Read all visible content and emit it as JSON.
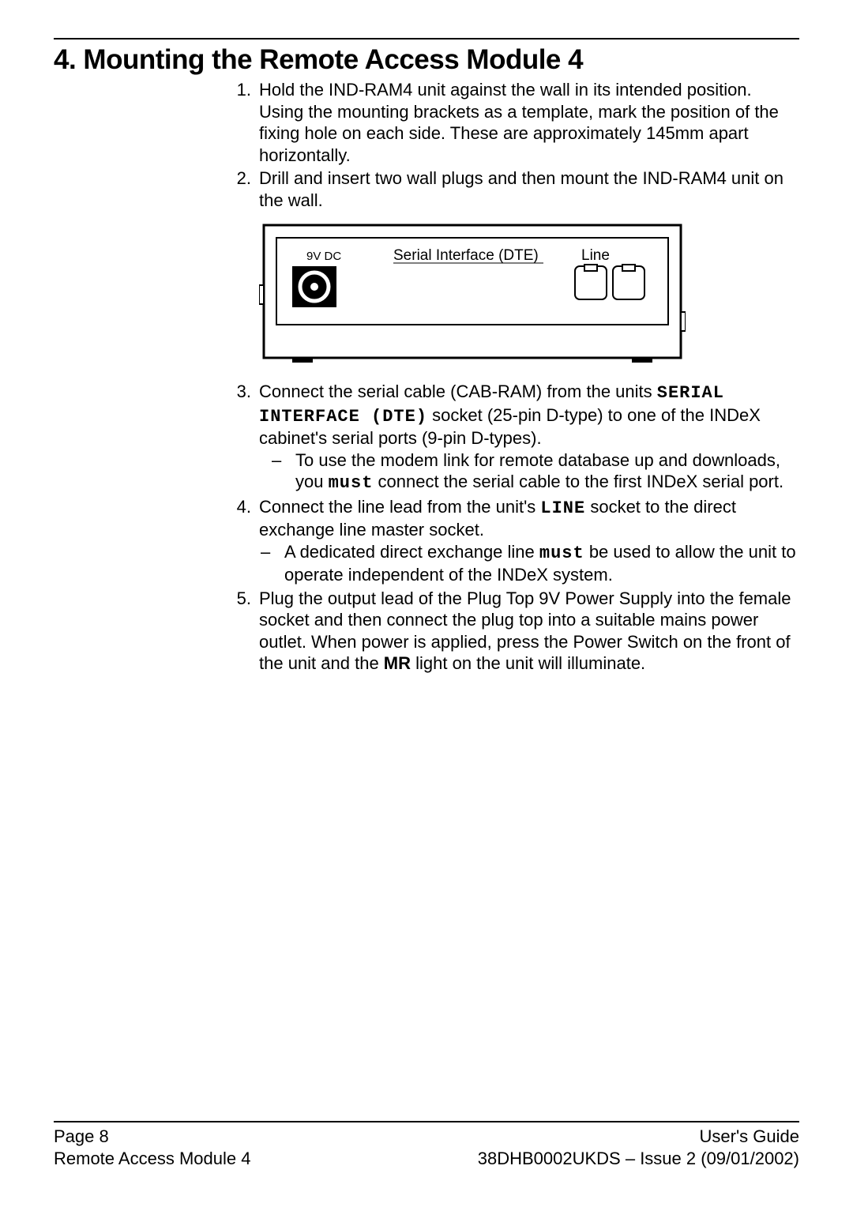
{
  "heading": "4. Mounting the Remote Access Module 4",
  "steps": {
    "s1": "Hold the IND-RAM4 unit against the wall in its intended position. Using the mounting brackets as a template, mark the position of the fixing hole on each side. These are approximately 145mm apart horizontally.",
    "s2": "Drill and insert two wall plugs and then mount the IND-RAM4 unit on the wall.",
    "s3_a": "Connect the serial cable (CAB-RAM) from the units ",
    "s3_b": "SERIAL INTERFACE (DTE)",
    "s3_c": " socket (25-pin D-type) to one of the INDeX cabinet's serial ports (9-pin D-types).",
    "s3_sub_a": "To use the modem link for remote database up and downloads, you ",
    "s3_sub_b": "must",
    "s3_sub_c": " connect the serial cable to the first INDeX serial port.",
    "s4_a": "Connect the line lead from the unit's ",
    "s4_b": "LINE",
    "s4_c": " socket to the direct exchange line master socket.",
    "s4_sub_a": "A dedicated direct exchange line ",
    "s4_sub_b": "must",
    "s4_sub_c": " be used to allow the unit to operate independent of the INDeX system.",
    "s5_a": "Plug the output lead of the Plug Top 9V Power Supply into the female socket and then connect the plug top into a suitable mains power outlet. When power is applied, press the Power Switch on the front of the unit and the ",
    "s5_b": "MR",
    "s5_c": " light on the unit will illuminate."
  },
  "diagram": {
    "label_power": "9V DC",
    "label_serial": "Serial Interface (DTE)",
    "label_line": "Line"
  },
  "footer": {
    "left1": "Page 8",
    "left2": "Remote Access Module 4",
    "right1": "User's Guide",
    "right2": "38DHB0002UKDS – Issue 2 (09/01/2002)"
  }
}
